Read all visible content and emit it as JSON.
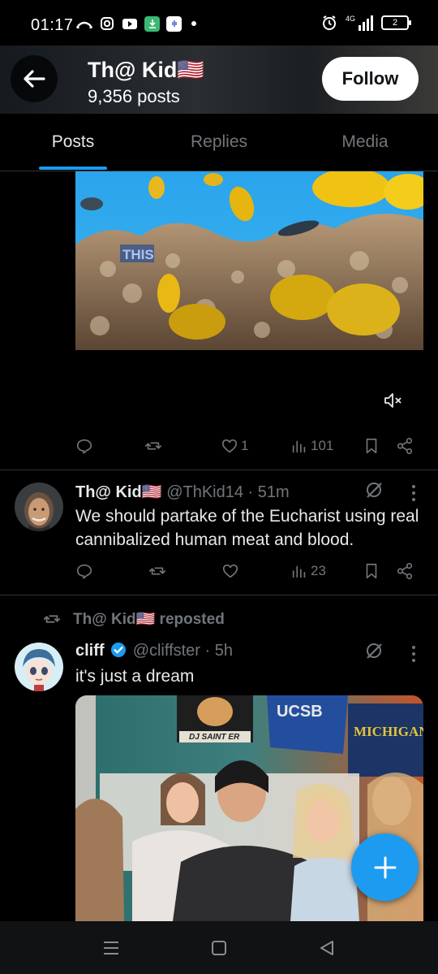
{
  "status_bar": {
    "time": "01:17",
    "network": "4G",
    "battery": "2"
  },
  "profile_header": {
    "name": "Th@ Kid🇺🇸",
    "post_count": "9,356 posts",
    "follow_label": "Follow"
  },
  "tabs": [
    {
      "label": "Posts",
      "active": true
    },
    {
      "label": "Replies",
      "active": false
    },
    {
      "label": "Media",
      "active": false
    }
  ],
  "posts": [
    {
      "media_caption": "THIS",
      "actions": {
        "replies": "",
        "reposts": "",
        "likes": "1",
        "views": "101"
      }
    },
    {
      "author_name": "Th@ Kid🇺🇸",
      "handle": "@ThKid14",
      "time": "51m",
      "text": "We should partake of the Eucharist using real cannibalized human meat and blood.",
      "actions": {
        "replies": "",
        "reposts": "",
        "likes": "",
        "views": "23"
      }
    },
    {
      "repost_label": "Th@ Kid🇺🇸 reposted",
      "author_name": "cliff",
      "verified": true,
      "handle": "@cliffster",
      "time": "5h",
      "text": "it's just a dream",
      "media_signs": [
        "DJ SAINT ER",
        "UCSB",
        "MICHIGAN"
      ]
    }
  ],
  "colors": {
    "accent": "#1d9bf0",
    "background": "#000000",
    "muted_text": "#71767b",
    "divider": "#2f3336"
  }
}
